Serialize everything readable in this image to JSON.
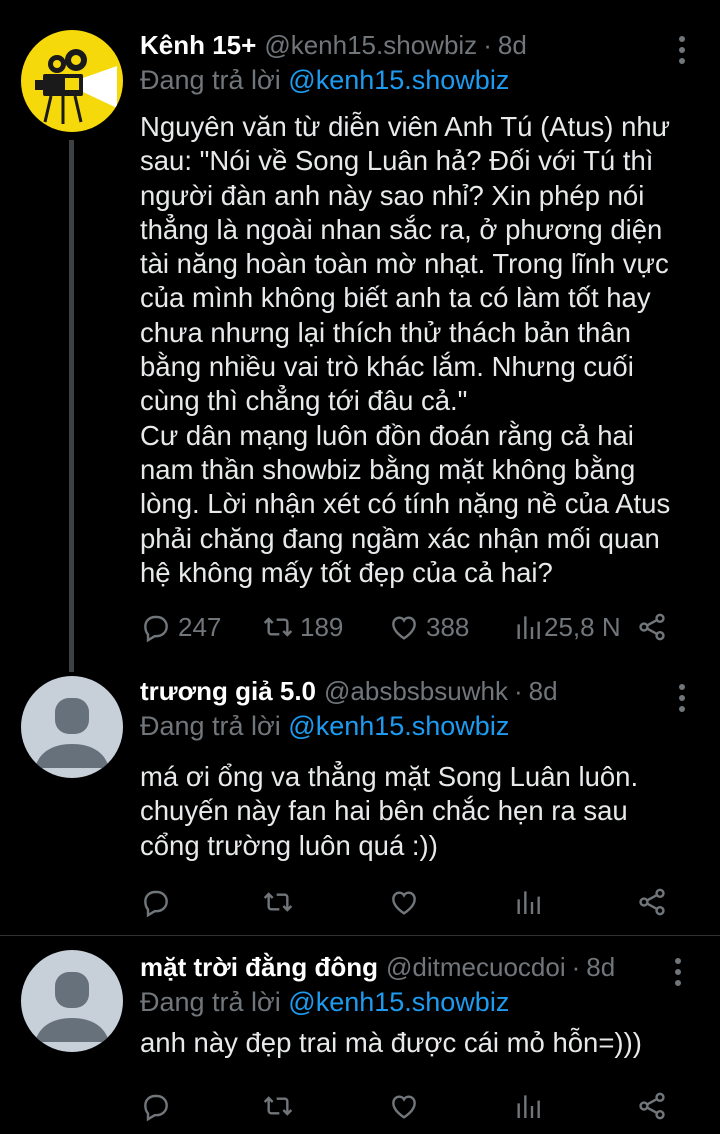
{
  "tweets": [
    {
      "name": "Kênh 15+",
      "handle": "@kenh15.showbiz",
      "time": "8d",
      "reply_prefix": "Đang trả lời",
      "reply_to": "@kenh15.showbiz",
      "text": "Nguyên văn từ diễn viên Anh Tú (Atus) như\nsau: \"Nói về Song Luân hả? Đối với Tú thì\nngười đàn anh này sao nhỉ? Xin phép nói\nthẳng là ngoài nhan sắc ra, ở phương diện\ntài năng hoàn toàn mờ nhạt. Trong lĩnh vực\ncủa mình không biết anh ta có làm tốt hay\nchưa nhưng lại thích thử thách bản thân\nbằng nhiều vai trò khác lắm. Nhưng cuối\ncùng thì chẳng tới đâu cả.\"\nCư dân mạng luôn đồn đoán rằng cả hai\nnam thần showbiz bằng mặt không bằng\nlòng. Lời nhận xét có tính nặng nề của Atus\nphải chăng đang ngầm xác nhận mối quan\nhệ không mấy tốt đẹp của cả hai?",
      "replies": "247",
      "retweets": "189",
      "likes": "388",
      "views": "25,8 N"
    },
    {
      "name": "trương giả 5.0",
      "handle": "@absbsbsuwhk",
      "time": "8d",
      "reply_prefix": "Đang trả lời",
      "reply_to": "@kenh15.showbiz",
      "text": "má ơi ổng va thẳng mặt Song Luân luôn.\nchuyến này fan hai bên chắc hẹn ra sau\ncổng trường luôn quá :))"
    },
    {
      "name": "mặt trời đằng đông",
      "handle": "@ditmecuocdoi",
      "time": "8d",
      "reply_prefix": "Đang trả lời",
      "reply_to": "@kenh15.showbiz",
      "text": "anh này đẹp trai mà được cái mỏ hỗn=)))"
    }
  ],
  "colors": {
    "background": "#000000",
    "text": "#e7e9ea",
    "muted": "#71767b",
    "mention": "#1d9bf0",
    "avatar_yellow": "#f5d90a",
    "avatar_gray": "#c7d0d8"
  },
  "icons": [
    "reply-icon",
    "retweet-icon",
    "like-icon",
    "views-icon",
    "share-icon",
    "more-icon",
    "projector-logo-icon",
    "default-avatar-icon"
  ]
}
